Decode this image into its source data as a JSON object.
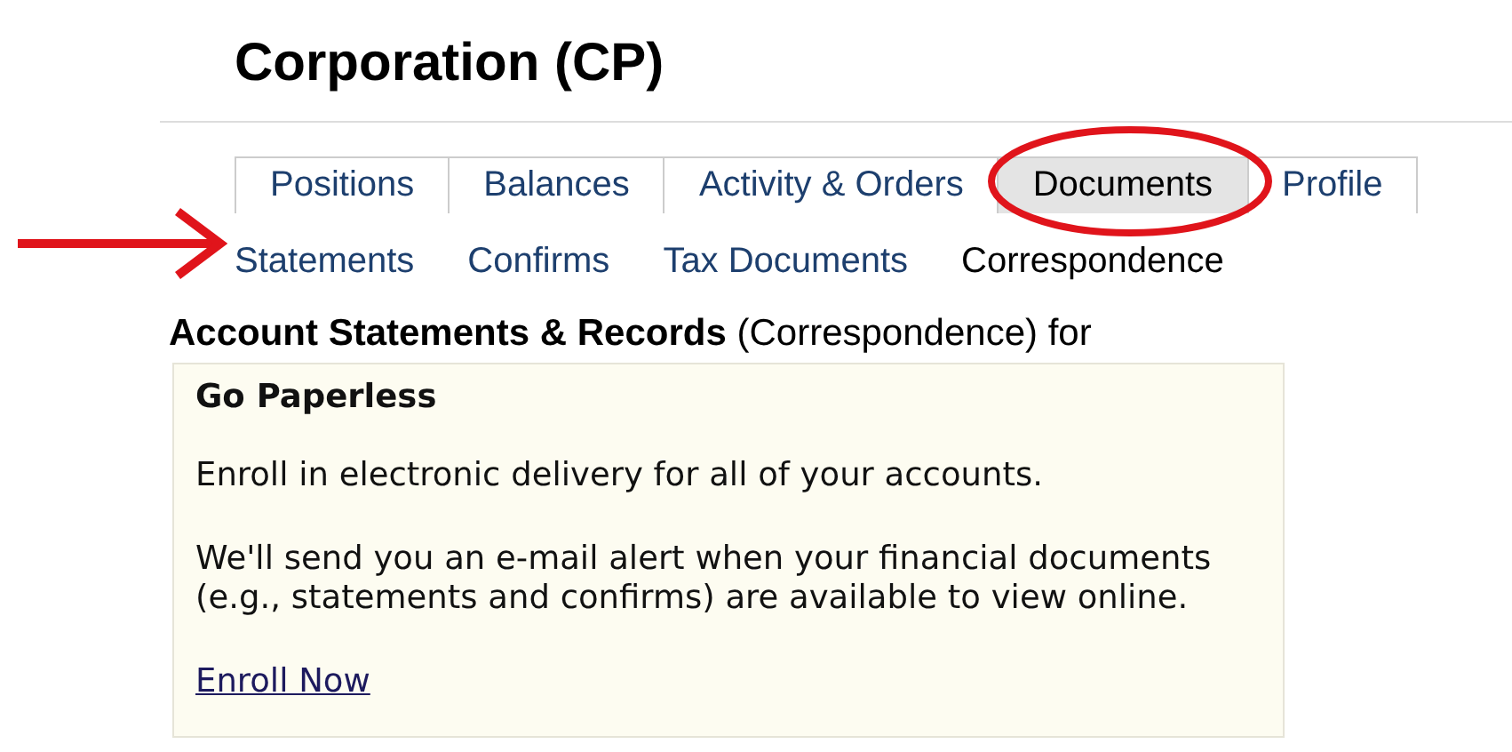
{
  "page_title": "Corporation (CP)",
  "tabs": [
    {
      "label": "Positions",
      "selected": false
    },
    {
      "label": "Balances",
      "selected": false
    },
    {
      "label": "Activity & Orders",
      "selected": false
    },
    {
      "label": "Documents",
      "selected": true
    },
    {
      "label": "Profile",
      "selected": false
    }
  ],
  "subtabs": [
    {
      "label": "Statements",
      "selected": false
    },
    {
      "label": "Confirms",
      "selected": false
    },
    {
      "label": "Tax Documents",
      "selected": false
    },
    {
      "label": "Correspondence",
      "selected": true
    }
  ],
  "section_heading": "**Account Statements & Records** (Correspondence) for",
  "paperless_box": {
    "title": "Go Paperless",
    "paragraphs": [
      "Enroll in electronic delivery for all of your accounts.",
      "We'll send you an e-mail alert when your financial documents (e.g., statements and confirms) are available to view online."
    ],
    "link": "Enroll Now"
  },
  "annotations": [
    {
      "kind": "ellipse"
    },
    {
      "kind": "arrow"
    }
  ]
}
